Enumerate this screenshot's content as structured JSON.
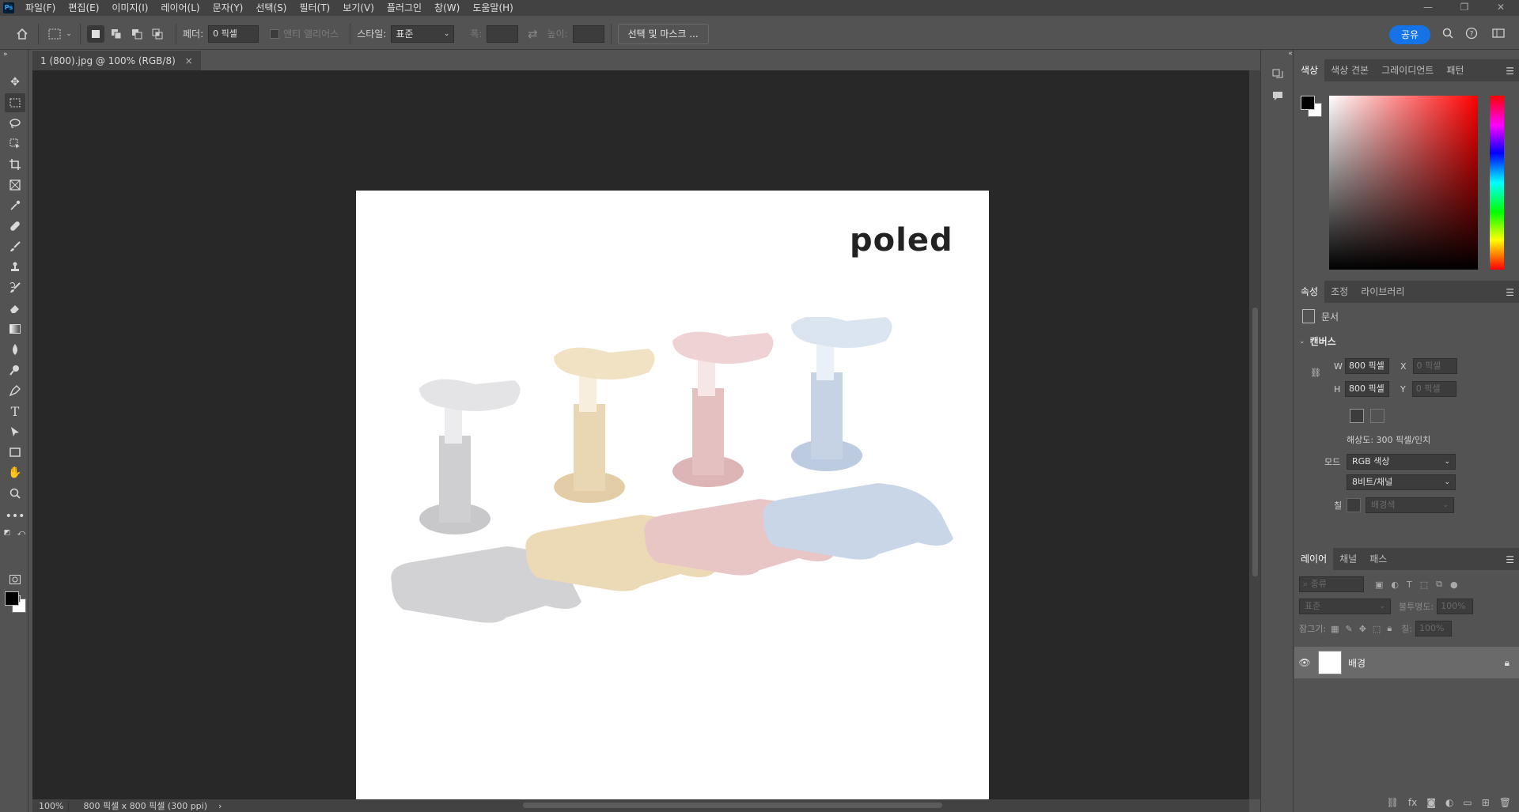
{
  "app": {
    "logo_text": "Ps"
  },
  "menu": [
    "파일(F)",
    "편집(E)",
    "이미지(I)",
    "레이어(L)",
    "문자(Y)",
    "선택(S)",
    "필터(T)",
    "보기(V)",
    "플러그인",
    "창(W)",
    "도움말(H)"
  ],
  "window_controls": {
    "minimize": "—",
    "restore": "❐",
    "close": "✕"
  },
  "options": {
    "feather_label": "페더:",
    "feather_value": "0 픽셀",
    "antialias_label": "앤티 앨리어스",
    "style_label": "스타일:",
    "style_value": "표준",
    "width_label": "폭:",
    "height_label": "높이:",
    "select_mask_button": "선택 및 마스크 ...",
    "share_button": "공유"
  },
  "document": {
    "tab_title": "1 (800).jpg @ 100% (RGB/8)",
    "tab_close": "×",
    "brand_logo": "poled"
  },
  "status": {
    "zoom": "100%",
    "doc_size": "800 픽셀 x 800 픽셀 (300 ppi)",
    "arrow": "›"
  },
  "color_panel": {
    "tabs": [
      "색상",
      "색상 견본",
      "그레이디언트",
      "패턴"
    ]
  },
  "properties_panel": {
    "tabs": [
      "속성",
      "조정",
      "라이브러리"
    ],
    "doc_label": "문서",
    "canvas_section": "캔버스",
    "w_label": "W",
    "w_value": "800 픽셀",
    "h_label": "H",
    "h_value": "800 픽셀",
    "x_label": "X",
    "x_placeholder": "0 픽셀",
    "y_label": "Y",
    "y_placeholder": "0 픽셀",
    "resolution": "해상도: 300 픽셀/인치",
    "mode_label": "모드",
    "mode_value": "RGB 색상",
    "depth_value": "8비트/채널",
    "fill_label": "칠",
    "fill_value": "배경색"
  },
  "layers_panel": {
    "tabs": [
      "레이어",
      "채널",
      "패스"
    ],
    "filter_placeholder": "종류",
    "blend_mode": "표준",
    "opacity_label": "불투명도:",
    "opacity_value": "100%",
    "lock_label": "잠그기:",
    "fill_label": "칠:",
    "fill_value": "100%",
    "layer_name": "배경"
  },
  "colors": {
    "accent": "#1473e6",
    "panel_bg": "#535353",
    "canvas_bg": "#282828",
    "menubar_bg": "#424242"
  }
}
